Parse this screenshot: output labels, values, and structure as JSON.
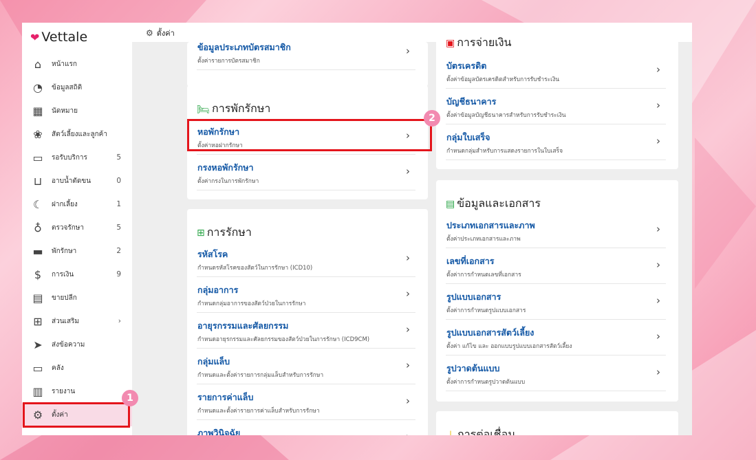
{
  "app": {
    "name": "Vettale",
    "accent": "#e6226b"
  },
  "breadcrumb": {
    "icon": "gear-icon",
    "label": "ตั้งค่า"
  },
  "sidebar": {
    "items": [
      {
        "label": "หน้าแรก",
        "icon": "home-icon",
        "count": ""
      },
      {
        "label": "ข้อมูลสถิติ",
        "icon": "stats-icon",
        "count": ""
      },
      {
        "label": "นัดหมาย",
        "icon": "calendar-icon",
        "count": ""
      },
      {
        "label": "สัตว์เลี้ยงและลูกค้า",
        "icon": "paw-icon",
        "count": ""
      },
      {
        "label": "รอรับบริการ",
        "icon": "sofa-icon",
        "count": "5"
      },
      {
        "label": "อาบน้ำตัดขน",
        "icon": "bathtub-icon",
        "count": "0"
      },
      {
        "label": "ฝากเลี้ยง",
        "icon": "moon-icon",
        "count": "1"
      },
      {
        "label": "ตรวจรักษา",
        "icon": "stethoscope-icon",
        "count": "5"
      },
      {
        "label": "พักรักษา",
        "icon": "bed-icon",
        "count": "2"
      },
      {
        "label": "การเงิน",
        "icon": "money-icon",
        "count": "9"
      },
      {
        "label": "ขายปลีก",
        "icon": "cash-register-icon",
        "count": ""
      },
      {
        "label": "ส่วนเสริม",
        "icon": "plus-box-icon",
        "count": "›"
      },
      {
        "label": "ส่งข้อความ",
        "icon": "send-icon",
        "count": ""
      },
      {
        "label": "คลัง",
        "icon": "archive-icon",
        "count": ""
      },
      {
        "label": "รายงาน",
        "icon": "report-icon",
        "count": ""
      },
      {
        "label": "ตั้งค่า",
        "icon": "gear-icon",
        "count": ""
      }
    ]
  },
  "steps": {
    "one": "1",
    "two": "2"
  },
  "member": {
    "title": "ข้อมูลประเภทบัตรสมาชิก",
    "desc": "ตั้งค่ารายการบัตรสมาชิก"
  },
  "hospital": {
    "title": "การพักรักษา",
    "items": [
      {
        "title": "หอพักรักษา",
        "desc": "ตั้งค่าหอฝากรักษา"
      },
      {
        "title": "กรงหอพักรักษา",
        "desc": "ตั้งค่ากรงในการพักรักษา"
      }
    ]
  },
  "treatment": {
    "title": "การรักษา",
    "items": [
      {
        "title": "รหัสโรค",
        "desc": "กำหนดรหัสโรคของสัตว์ในการรักษา (ICD10)"
      },
      {
        "title": "กลุ่มอาการ",
        "desc": "กำหนดกลุ่มอาการของสัตว์ป่วยในการรักษา"
      },
      {
        "title": "อายุรกรรมและศัลยกรรม",
        "desc": "กำหนดอายุรกรรมและศัลยกรรมของสัตว์ป่วยในการรักษา (ICD9CM)"
      },
      {
        "title": "กลุ่มแล็บ",
        "desc": "กำหนดและตั้งค่ารายการกลุ่มแล็บสำหรับการรักษา"
      },
      {
        "title": "รายการค่าแล็บ",
        "desc": "กำหนดและตั้งค่ารายการค่าแล็บสำหรับการรักษา"
      },
      {
        "title": "ภาพวินิจฉัย",
        "desc": ""
      }
    ]
  },
  "payment": {
    "title": "การจ่ายเงิน",
    "items": [
      {
        "title": "บัตรเครดิต",
        "desc": "ตั้งค่าข้อมูลบัตรเครดิตสำหรับการรับชำระเงิน"
      },
      {
        "title": "บัญชีธนาคาร",
        "desc": "ตั้งค่าข้อมูลบัญชีธนาคารสำหรับการรับชำระเงิน"
      },
      {
        "title": "กลุ่มใบเสร็จ",
        "desc": "กำหนดกลุ่มสำหรับการแสดงรายการในใบเสร็จ"
      }
    ]
  },
  "docs": {
    "title": "ข้อมูลและเอกสาร",
    "items": [
      {
        "title": "ประเภทเอกสารและภาพ",
        "desc": "ตั้งค่าประเภทเอกสารและภาพ"
      },
      {
        "title": "เลขที่เอกสาร",
        "desc": "ตั้งค่าการกำหนดเลขที่เอกสาร"
      },
      {
        "title": "รูปแบบเอกสาร",
        "desc": "ตั้งค่าการกำหนดรูปแบบเอกสาร"
      },
      {
        "title": "รูปแบบเอกสารสัตว์เลี้ยง",
        "desc": "ตั้งค่า แก้ไข และ ออกแบบรูปแบบเอกสารสัตว์เลี้ยง"
      },
      {
        "title": "รูปวาดต้นแบบ",
        "desc": "ตั้งค่าการกำหนดรูปวาดต้นแบบ"
      }
    ]
  },
  "connect": {
    "title": "การต่อเชื่อม"
  },
  "chevron": "›"
}
